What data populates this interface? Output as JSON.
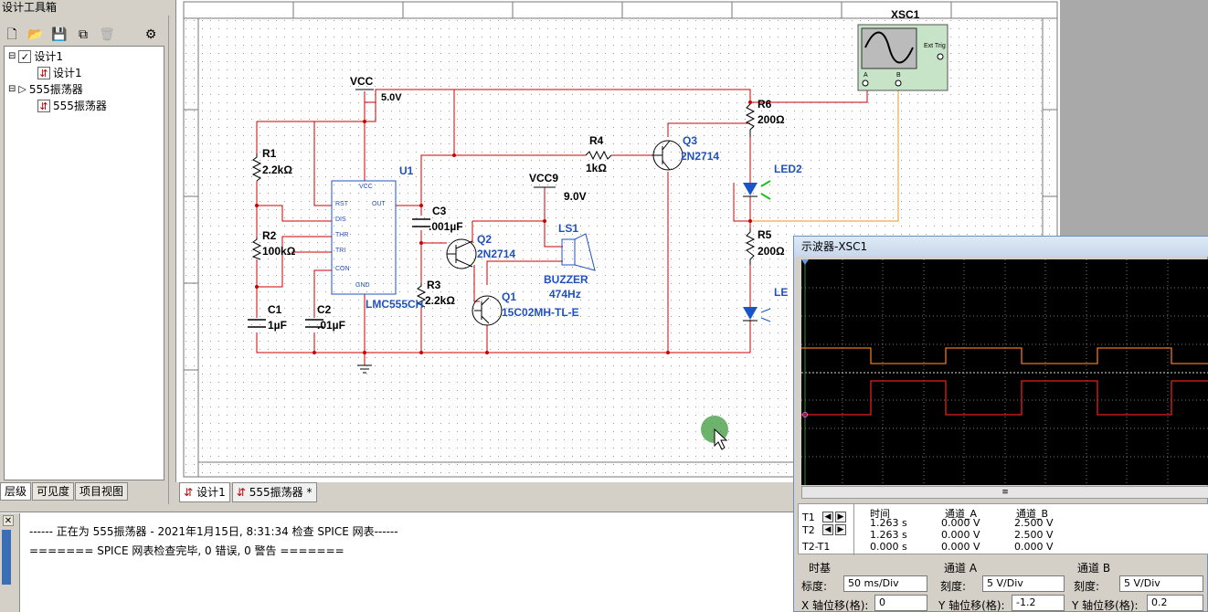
{
  "toolbox": {
    "title": "设计工具箱",
    "tree": [
      {
        "label": "设计1"
      },
      {
        "label": "设计1"
      },
      {
        "label": "555振荡器"
      },
      {
        "label": "555振荡器"
      }
    ],
    "tabs": [
      "层级",
      "可见度",
      "项目视图"
    ]
  },
  "schematic": {
    "tabs": [
      "设计1",
      "555振荡器 *"
    ],
    "labels": {
      "vcc": "VCC",
      "vcc_v": "5.0V",
      "r1": "R1",
      "r1_v": "2.2kΩ",
      "r2": "R2",
      "r2_v": "100kΩ",
      "c1": "C1",
      "c1_v": "1µF",
      "c2": "C2",
      "c2_v": ".01µF",
      "u1": "U1",
      "u1_part": "LMC555CH",
      "pin_vcc": "VCC",
      "pin_rst": "RST",
      "pin_out": "OUT",
      "pin_dis": "DIS",
      "pin_thr": "THR",
      "pin_tri": "TRI",
      "pin_con": "CON",
      "pin_gnd": "GND",
      "c3": "C3",
      "c3_v": ".001µF",
      "q2": "Q2",
      "q2_v": "2N2714",
      "r3": "R3",
      "r3_v": "2.2kΩ",
      "q1": "Q1",
      "q1_v": "15C02MH-TL-E",
      "vcc9": "VCC9",
      "vcc9_v": "9.0V",
      "ls1": "LS1",
      "buzzer": "BUZZER",
      "buzzer_f": "474Hz",
      "r4": "R4",
      "r4_v": "1kΩ",
      "q3": "Q3",
      "q3_v": "2N2714",
      "r6": "R6",
      "r6_v": "200Ω",
      "led2": "LED2",
      "r5": "R5",
      "r5_v": "200Ω",
      "led_partial": "LE",
      "xsc1": "XSC1",
      "ext_trig": "Ext Trig",
      "ch_a": "A",
      "ch_b": "B"
    }
  },
  "console": {
    "line1": "------ 正在为 555振荡器 - 2021年1月15日, 8:31:34 检查 SPICE 网表------",
    "line2": "======= SPICE 网表检查完毕, 0 错误, 0 警告 ======="
  },
  "scope": {
    "title": "示波器-XSC1",
    "readout": {
      "col_time": "时间",
      "col_a": "通道_A",
      "col_b": "通道_B",
      "t1_label": "T1",
      "t2_label": "T2",
      "t21_label": "T2-T1",
      "t1": {
        "time": "1.263 s",
        "a": "0.000 V",
        "b": "2.500 V"
      },
      "t2": {
        "time": "1.263 s",
        "a": "0.000 V",
        "b": "2.500 V"
      },
      "t21": {
        "time": "0.000 s",
        "a": "0.000 V",
        "b": "0.000 V"
      }
    },
    "timebase": {
      "heading": "时基",
      "scale_label": "标度:",
      "scale": "50 ms/Div",
      "xpos_label": "X 轴位移(格):",
      "xpos": "0"
    },
    "channel_a": {
      "heading": "通道 A",
      "scale_label": "刻度:",
      "scale": "5  V/Div",
      "ypos_label": "Y 轴位移(格):",
      "ypos": "-1.2"
    },
    "channel_b": {
      "heading": "通道 B",
      "scale_label": "刻度:",
      "scale": "5  V/Div",
      "ypos_label": "Y 轴位移(格):",
      "ypos": "0.2"
    },
    "colors": {
      "channel_a": "#e8781e",
      "channel_b": "#e02020"
    }
  }
}
